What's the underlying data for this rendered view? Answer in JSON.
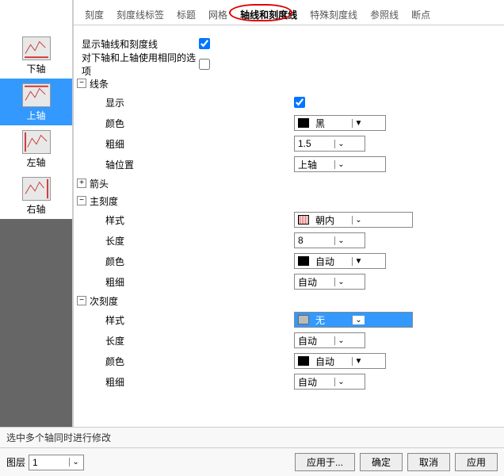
{
  "sidebar": {
    "items": [
      {
        "label": "下轴"
      },
      {
        "label": "上轴"
      },
      {
        "label": "左轴"
      },
      {
        "label": "右轴"
      }
    ]
  },
  "tabs": [
    {
      "label": "刻度"
    },
    {
      "label": "刻度线标签"
    },
    {
      "label": "标题"
    },
    {
      "label": "网格"
    },
    {
      "label": "轴线和刻度线"
    },
    {
      "label": "特殊刻度线"
    },
    {
      "label": "参照线"
    },
    {
      "label": "断点"
    }
  ],
  "panel": {
    "show_axes_label": "显示轴线和刻度线",
    "same_opts_label": "对下轴和上轴使用相同的选项",
    "section_line": "线条",
    "line_show": "显示",
    "line_color_label": "颜色",
    "line_color_value": "黑",
    "line_weight_label": "粗细",
    "line_weight_value": "1.5",
    "axis_pos_label": "轴位置",
    "axis_pos_value": "上轴",
    "arrow_label": "箭头",
    "section_major": "主刻度",
    "major_style_label": "样式",
    "major_style_value": "朝内",
    "major_len_label": "长度",
    "major_len_value": "8",
    "major_color_label": "颜色",
    "major_color_value": "自动",
    "major_weight_label": "粗细",
    "major_weight_value": "自动",
    "section_minor": "次刻度",
    "minor_style_label": "样式",
    "minor_style_value": "无",
    "minor_len_label": "长度",
    "minor_len_value": "自动",
    "minor_color_label": "颜色",
    "minor_color_value": "自动",
    "minor_weight_label": "粗细",
    "minor_weight_value": "自动"
  },
  "footer": {
    "hint": "选中多个轴同时进行修改",
    "layer_label": "图层",
    "layer_value": "1",
    "apply_to": "应用于...",
    "ok": "确定",
    "cancel": "取消",
    "apply": "应用"
  }
}
